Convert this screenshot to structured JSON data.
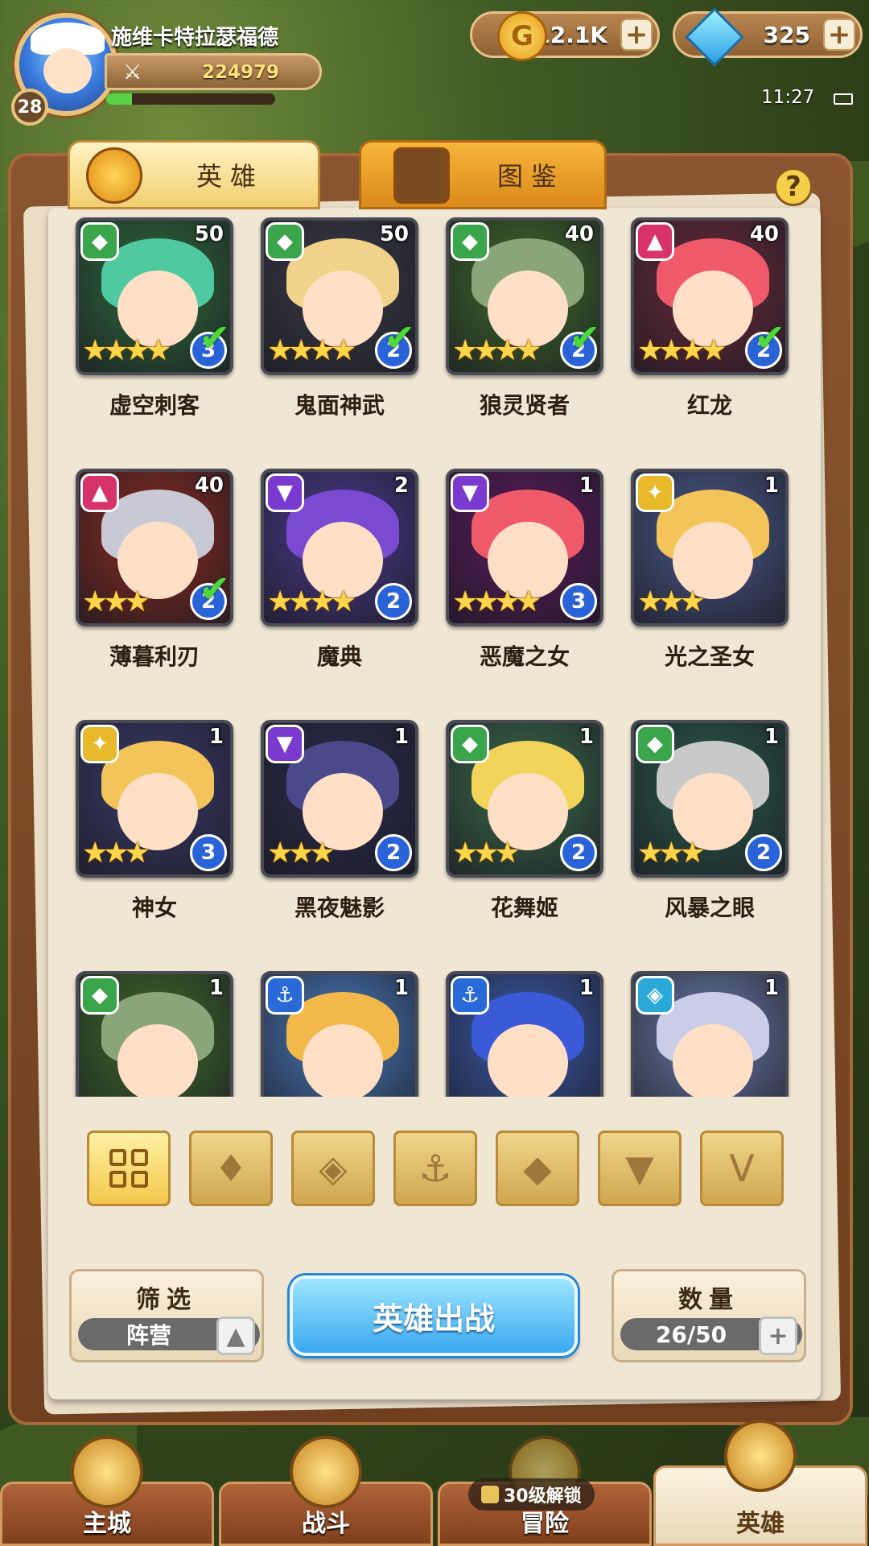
{
  "player": {
    "name": "施维卡特拉瑟福德",
    "level": "28",
    "power": "224979",
    "xp_progress": 0.15
  },
  "resources": {
    "gold": "112.1K",
    "gems": "325"
  },
  "status": {
    "time": "11:27"
  },
  "tabs": [
    {
      "label": "英雄"
    },
    {
      "label": "图鉴"
    }
  ],
  "help_label": "?",
  "heroes": [
    {
      "name": "虚空刺客",
      "level": "50",
      "stars": "★★★★",
      "rank": "3",
      "ready": true,
      "faction": "beast",
      "color": "#3aa54a",
      "bg": "#2f6a3a",
      "hair": "#4fc9a0"
    },
    {
      "name": "鬼面神武",
      "level": "50",
      "stars": "★★★★",
      "rank": "2",
      "ready": true,
      "faction": "beast",
      "color": "#3aa54a",
      "bg": "#3a3a46",
      "hair": "#f1d28a"
    },
    {
      "name": "狼灵贤者",
      "level": "40",
      "stars": "★★★★",
      "rank": "2",
      "ready": true,
      "faction": "beast",
      "color": "#3aa54a",
      "bg": "#3f6a2a",
      "hair": "#8aa57a"
    },
    {
      "name": "红龙",
      "level": "40",
      "stars": "★★★★",
      "rank": "2",
      "ready": true,
      "faction": "dragon",
      "color": "#d8326a",
      "bg": "#6a2a3a",
      "hair": "#ef5a6a"
    },
    {
      "name": "薄暮利刃",
      "level": "40",
      "stars": "★★★",
      "rank": "2",
      "ready": true,
      "faction": "dragon",
      "color": "#d8326a",
      "bg": "#8a2a20",
      "hair": "#c9c9d6"
    },
    {
      "name": "魔典",
      "level": "2",
      "stars": "★★★★",
      "rank": "2",
      "ready": false,
      "faction": "demon",
      "color": "#7a3ad0",
      "bg": "#4a3a8a",
      "hair": "#7a4ad0"
    },
    {
      "name": "恶魔之女",
      "level": "1",
      "stars": "★★★★",
      "rank": "3",
      "ready": false,
      "faction": "demon",
      "color": "#7a3ad0",
      "bg": "#5a1a5a",
      "hair": "#ef5a6a"
    },
    {
      "name": "光之圣女",
      "level": "1",
      "stars": "★★★",
      "rank": "",
      "ready": false,
      "faction": "holy",
      "color": "#e8b92a",
      "bg": "#4a5a8a",
      "hair": "#f3c45a"
    },
    {
      "name": "神女",
      "level": "1",
      "stars": "★★★",
      "rank": "3",
      "ready": false,
      "faction": "holy",
      "color": "#e8b92a",
      "bg": "#3a3a6a",
      "hair": "#f3c45a"
    },
    {
      "name": "黑夜魅影",
      "level": "1",
      "stars": "★★★",
      "rank": "2",
      "ready": false,
      "faction": "demon",
      "color": "#7a3ad0",
      "bg": "#2a2a4a",
      "hair": "#4a4a8a"
    },
    {
      "name": "花舞姬",
      "level": "1",
      "stars": "★★★",
      "rank": "2",
      "ready": false,
      "faction": "beast",
      "color": "#3aa54a",
      "bg": "#3a6a4a",
      "hair": "#f3d45a"
    },
    {
      "name": "风暴之眼",
      "level": "1",
      "stars": "★★★",
      "rank": "2",
      "ready": false,
      "faction": "beast",
      "color": "#3aa54a",
      "bg": "#2a5a4a",
      "hair": "#c9c9c9"
    },
    {
      "name": "",
      "level": "1",
      "stars": "",
      "rank": "",
      "ready": false,
      "faction": "beast",
      "color": "#3aa54a",
      "bg": "#3f6a2a",
      "hair": "#8aa57a"
    },
    {
      "name": "",
      "level": "1",
      "stars": "",
      "rank": "",
      "ready": false,
      "faction": "ocean",
      "color": "#2a6ad8",
      "bg": "#4a7aba",
      "hair": "#f3b84a"
    },
    {
      "name": "",
      "level": "1",
      "stars": "",
      "rank": "",
      "ready": false,
      "faction": "ocean",
      "color": "#2a6ad8",
      "bg": "#3a5aa8",
      "hair": "#3a5ad8"
    },
    {
      "name": "",
      "level": "1",
      "stars": "",
      "rank": "",
      "ready": false,
      "faction": "nature",
      "color": "#2aa8d8",
      "bg": "#6a7aa8",
      "hair": "#c9cde8"
    }
  ],
  "filters": [
    {
      "name": "all",
      "icon": "grid-icon"
    },
    {
      "name": "dragon",
      "icon": "dragon-crest-icon"
    },
    {
      "name": "nature",
      "icon": "rhombus-crest-icon"
    },
    {
      "name": "ocean",
      "icon": "anchor-icon"
    },
    {
      "name": "beast",
      "icon": "beast-head-icon"
    },
    {
      "name": "demon",
      "icon": "demon-horns-icon"
    },
    {
      "name": "holy",
      "icon": "holy-wings-icon"
    }
  ],
  "controls": {
    "filter_label": "筛选",
    "filter_value": "阵营",
    "deploy_label": "英雄出战",
    "count_label": "数量",
    "count_value": "26/50"
  },
  "nav": [
    {
      "label": "主城"
    },
    {
      "label": "战斗"
    },
    {
      "label": "冒险"
    },
    {
      "label": "英雄"
    }
  ],
  "lock_text": "30级解锁",
  "glyphs": {
    "plus": "+",
    "coin": "G",
    "arrow_up": "▲",
    "check": "✔",
    "anchor": "⚓"
  }
}
